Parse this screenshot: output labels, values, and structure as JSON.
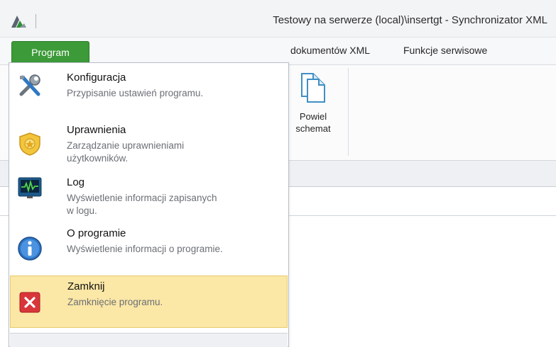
{
  "window": {
    "title": "Testowy na serwerze (local)\\insertgt - Synchronizator XML"
  },
  "ribbon": {
    "tabs": [
      {
        "label": "Program"
      },
      {
        "label": "dokumentów XML"
      },
      {
        "label": "Funkcje serwisowe"
      }
    ],
    "buttons": [
      {
        "label": "Powiel\nschemat",
        "icon": "duplicate-icon"
      }
    ]
  },
  "menu": {
    "items": [
      {
        "label": "Konfiguracja",
        "description": "Przypisanie ustawień programu.",
        "icon": "tools-icon"
      },
      {
        "label": "Uprawnienia",
        "description": "Zarządzanie uprawnieniami\nużytkowników.",
        "icon": "shield-icon"
      },
      {
        "label": "Log",
        "description": "Wyświetlenie informacji zapisanych\nw logu.",
        "icon": "log-monitor-icon"
      },
      {
        "label": "O programie",
        "description": "Wyświetlenie informacji o programie.",
        "icon": "info-icon"
      },
      {
        "label": "Zamknij",
        "description": "Zamknięcie programu.",
        "icon": "close-icon"
      }
    ]
  },
  "colors": {
    "program_tab": "#3c9a38",
    "close_highlight": "#fbe7a6"
  }
}
